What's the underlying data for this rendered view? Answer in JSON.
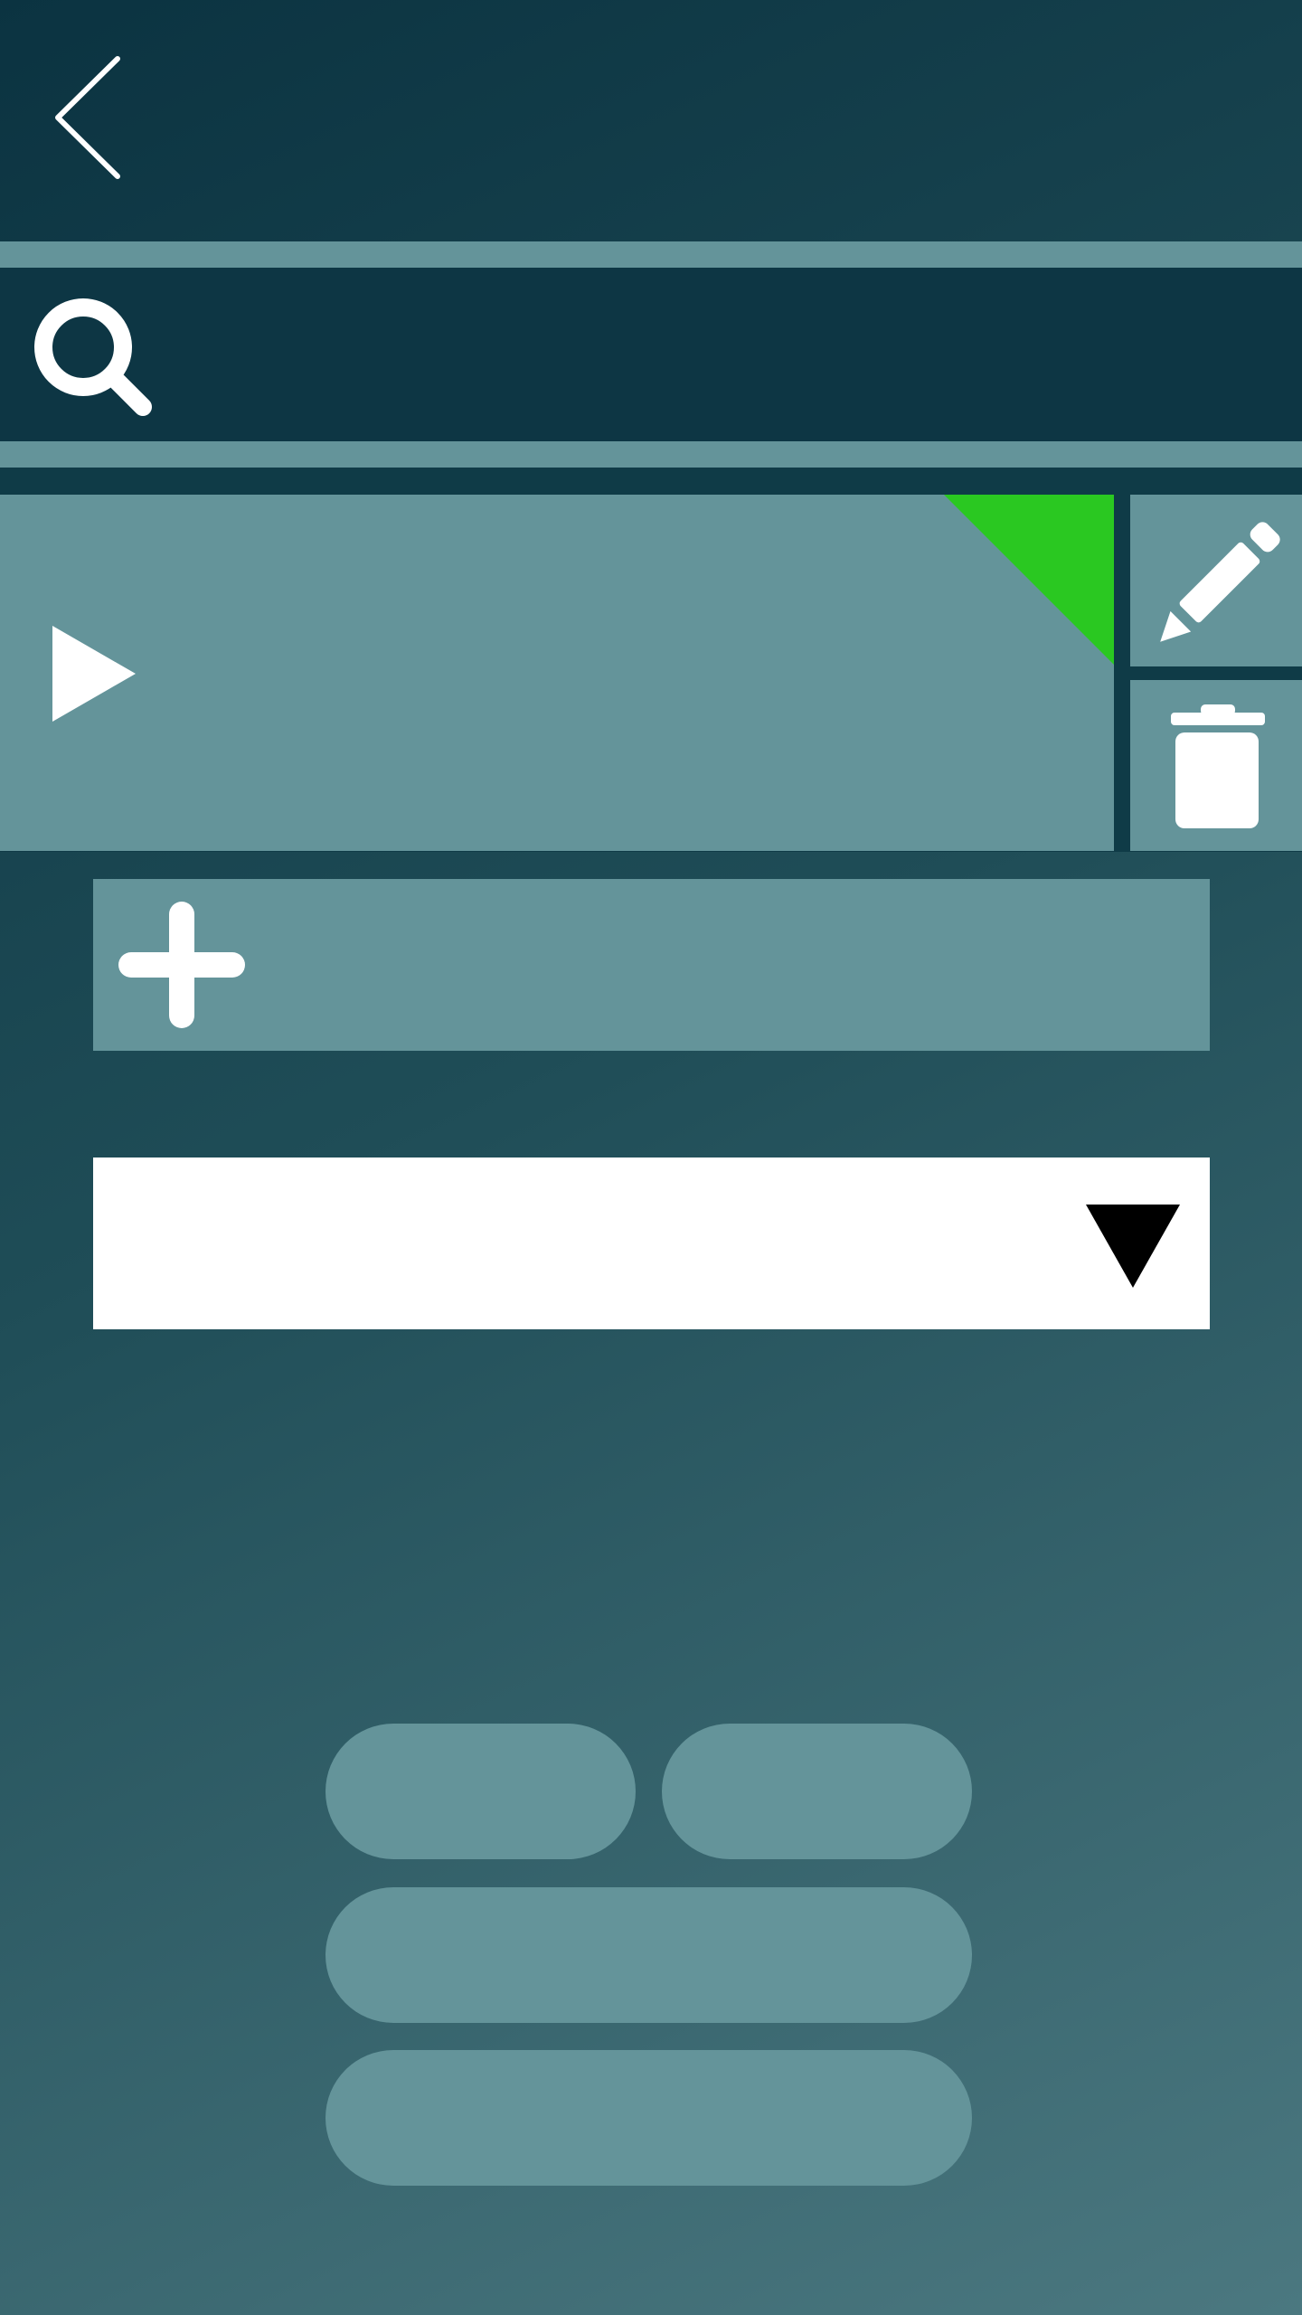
{
  "header": {
    "back_icon": "chevron-left-icon"
  },
  "search": {
    "icon": "search-icon",
    "placeholder": "",
    "value": ""
  },
  "list_item": {
    "icon": "play-icon",
    "status_color": "#2ac821",
    "edit_icon": "pencil-icon",
    "delete_icon": "trash-icon"
  },
  "add_button": {
    "icon": "plus-icon"
  },
  "dropdown": {
    "selected_value": "",
    "icon": "triangle-down-icon"
  },
  "pills": [
    {
      "label": ""
    },
    {
      "label": ""
    },
    {
      "label": ""
    },
    {
      "label": ""
    }
  ],
  "colors": {
    "background_start": "#0b3341",
    "background_end": "#4b7880",
    "panel": "#64949a",
    "dark_band": "#0d3644",
    "accent_green": "#2ac821",
    "white": "#ffffff"
  }
}
